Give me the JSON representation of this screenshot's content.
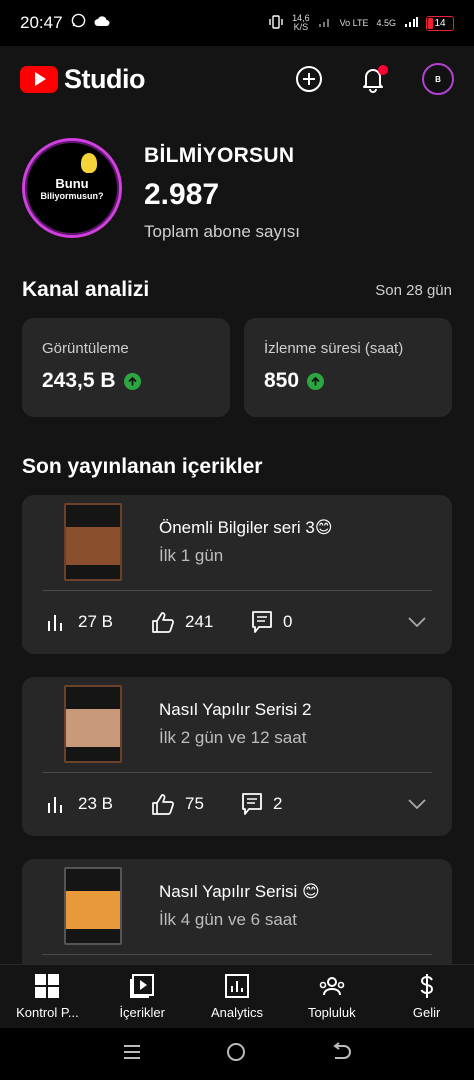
{
  "status_bar": {
    "time": "20:47",
    "net_speed": "14,6",
    "net_unit": "K/S",
    "volte": "Vo LTE",
    "network": "4.5G",
    "battery": "14"
  },
  "app": {
    "logo_text": "Studio",
    "accent": "#ff0000"
  },
  "channel": {
    "avatar_line1": "Bunu",
    "avatar_line2": "Biliyormusun?",
    "name": "BİLMİYORSUN",
    "subscribers": "2.987",
    "subscribers_label": "Toplam abone sayısı"
  },
  "analytics": {
    "title": "Kanal analizi",
    "period": "Son 28 gün",
    "views_label": "Görüntüleme",
    "views_value": "243,5 B",
    "watch_label": "İzlenme süresi (saat)",
    "watch_value": "850"
  },
  "recent": {
    "title": "Son yayınlanan içerikler",
    "videos": [
      {
        "title": "Önemli Bilgiler seri 3😊",
        "subtitle": "İlk 1 gün",
        "views": "27 B",
        "likes": "241",
        "comments": "0"
      },
      {
        "title": "Nasıl Yapılır Serisi 2",
        "subtitle": "İlk 2 gün ve 12 saat",
        "views": "23 B",
        "likes": "75",
        "comments": "2"
      },
      {
        "title": "Nasıl Yapılır Serisi 😊",
        "subtitle": "İlk 4 gün ve 6 saat"
      }
    ]
  },
  "bottom_nav": [
    {
      "label": "Kontrol P...",
      "icon": "dashboard-icon"
    },
    {
      "label": "İçerikler",
      "icon": "content-icon"
    },
    {
      "label": "Analytics",
      "icon": "analytics-icon"
    },
    {
      "label": "Topluluk",
      "icon": "community-icon"
    },
    {
      "label": "Gelir",
      "icon": "earn-icon"
    }
  ]
}
